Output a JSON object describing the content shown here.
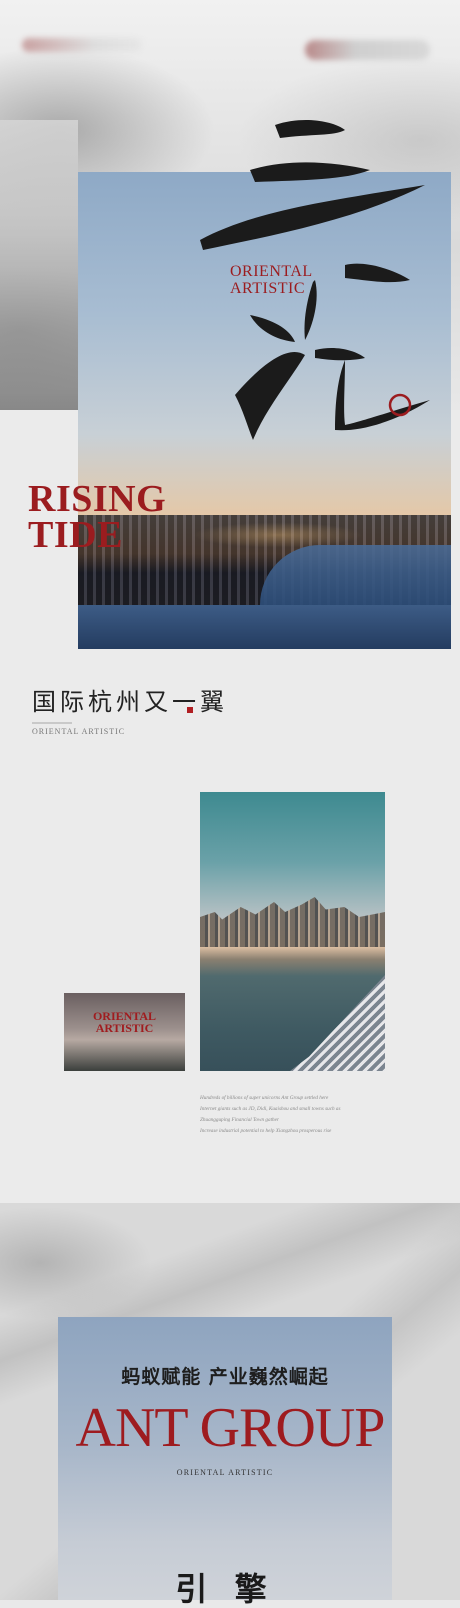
{
  "hero": {
    "calligraphy_text": "三江汇",
    "stacked_label_line1": "ORIENTAL",
    "stacked_label_line2": "ARTISTIC",
    "headline_line1": "RISING",
    "headline_line2": "TIDE"
  },
  "section_a": {
    "title_cn": "国际杭州又一翼",
    "subtitle_en": "ORIENTAL ARTISTIC",
    "inset_label_line1": "ORIENTAL",
    "inset_label_line2": "ARTISTIC",
    "paragraph_lines": [
      "Hundreds of billions of super unicorns Ant Group settled here",
      "Internet giants such as JD, Didi, Kuaishou and small towns such as",
      "Zhuangguping Financial Town gather",
      "Increase industrial potential to help Xiangzhou prosperous rise"
    ]
  },
  "section_b": {
    "tagline_cn": "蚂蚁赋能 产业巍然崛起",
    "headline": "ANT GROUP",
    "subline": "ORIENTAL ARTISTIC",
    "bottom_text_cn": "引 擎"
  },
  "colors": {
    "accent_red": "#9b1c1f",
    "background": "#e9e9e9"
  }
}
